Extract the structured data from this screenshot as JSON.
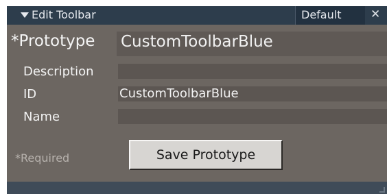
{
  "window": {
    "title": "Edit Toolbar",
    "default_label": "Default",
    "close_glyph": "✕",
    "expand_icon": "triangle-down-icon",
    "colors": {
      "titlebar": "#2d3d4c",
      "panel": "#6c6661",
      "footer": "#3f4b58"
    }
  },
  "form": {
    "prototype": {
      "label": "*Prototype",
      "value": "CustomToolbarBlue"
    },
    "fields": [
      {
        "label": "Description",
        "value": ""
      },
      {
        "label": "ID",
        "value": "CustomToolbarBlue"
      },
      {
        "label": "Name",
        "value": ""
      }
    ],
    "required_note": "*Required",
    "save_label": "Save Prototype"
  }
}
